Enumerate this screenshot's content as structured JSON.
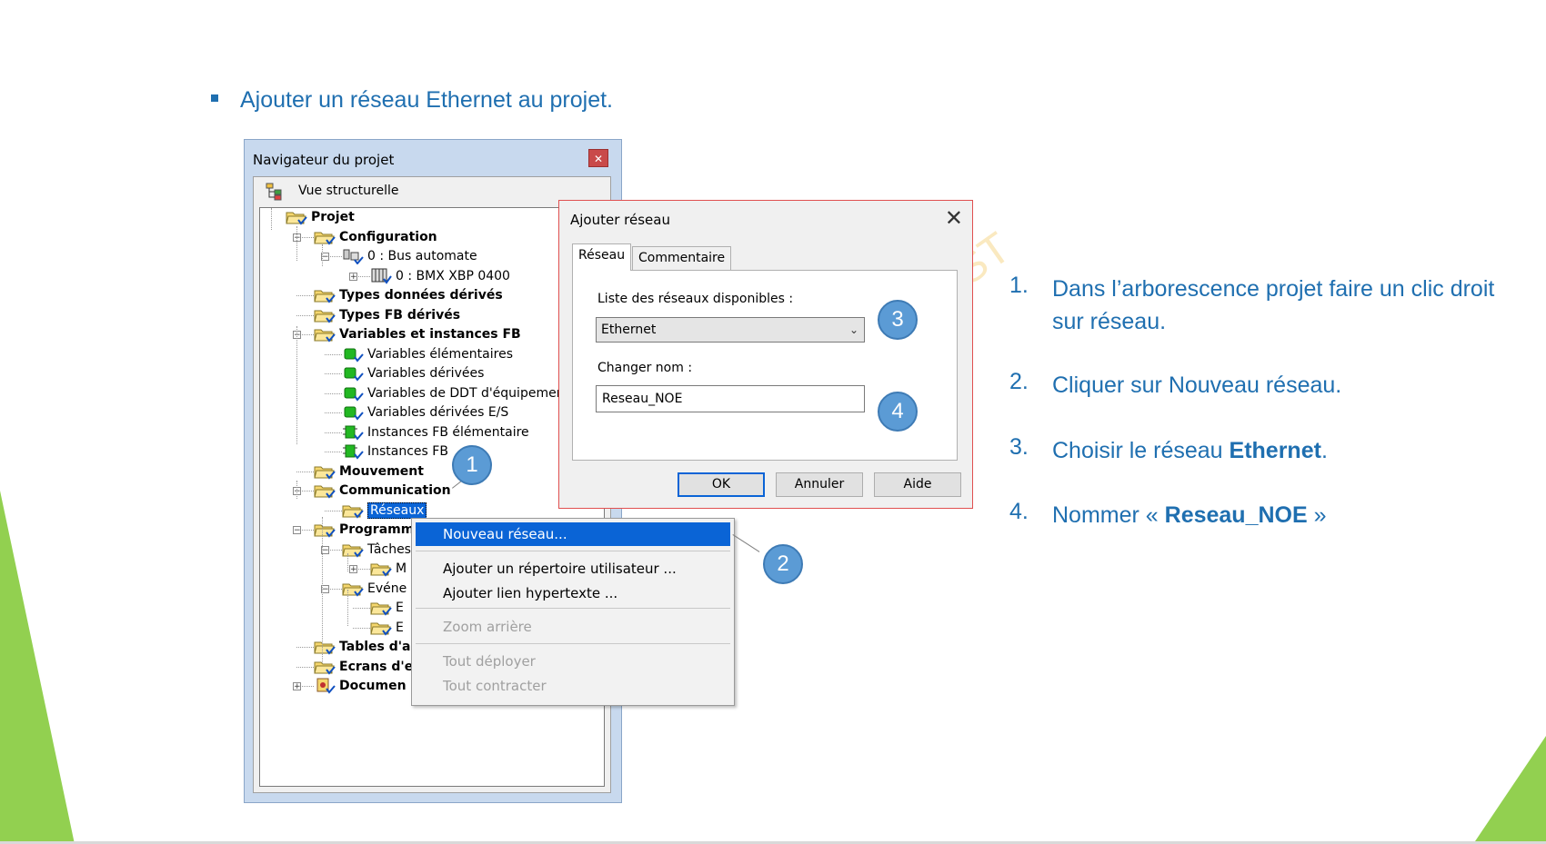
{
  "slide": {
    "title": "Ajouter un réseau Ethernet au projet.",
    "watermark": "ST",
    "colors": {
      "accent": "#1f6fb0",
      "green": "#92d050",
      "callout": "#5b9bd5"
    }
  },
  "navigator": {
    "title": "Navigateur du projet",
    "close_icon": "close-icon",
    "view_label": "Vue structurelle",
    "tree": [
      {
        "label": "Projet",
        "bold": true
      },
      {
        "label": "Configuration",
        "bold": true
      },
      {
        "label": "0 : Bus automate",
        "bold": false
      },
      {
        "label": "0 : BMX XBP 0400",
        "bold": false
      },
      {
        "label": "Types données dérivés",
        "bold": true
      },
      {
        "label": "Types FB dérivés",
        "bold": true
      },
      {
        "label": "Variables et instances FB",
        "bold": true
      },
      {
        "label": "Variables élémentaires",
        "bold": false
      },
      {
        "label": "Variables dérivées",
        "bold": false
      },
      {
        "label": "Variables de DDT d'équipement",
        "bold": false
      },
      {
        "label": "Variables dérivées E/S",
        "bold": false
      },
      {
        "label": "Instances FB élémentaire",
        "bold": false
      },
      {
        "label": "Instances FB",
        "bold": false
      },
      {
        "label": "Mouvement",
        "bold": true
      },
      {
        "label": "Communication",
        "bold": true
      },
      {
        "label": "Réseaux",
        "bold": false,
        "selected": true
      },
      {
        "label": "Programm",
        "bold": true
      },
      {
        "label": "Tâches",
        "bold": false
      },
      {
        "label": "M",
        "bold": false
      },
      {
        "label": "Evéne",
        "bold": false
      },
      {
        "label": "E",
        "bold": false
      },
      {
        "label": "E",
        "bold": false
      },
      {
        "label": "Tables d'a",
        "bold": true
      },
      {
        "label": "Ecrans d'e",
        "bold": true
      },
      {
        "label": "Documen",
        "bold": true
      }
    ]
  },
  "context_menu": {
    "items": [
      {
        "label": "Nouveau réseau...",
        "state": "highlighted"
      },
      {
        "label": "Ajouter un répertoire utilisateur ...",
        "state": "enabled"
      },
      {
        "label": "Ajouter lien hypertexte ...",
        "state": "enabled"
      },
      {
        "label": "Zoom arrière",
        "state": "disabled"
      },
      {
        "label": "Tout déployer",
        "state": "disabled"
      },
      {
        "label": "Tout contracter",
        "state": "disabled"
      }
    ]
  },
  "dialog": {
    "title": "Ajouter réseau",
    "tabs": [
      "Réseau",
      "Commentaire"
    ],
    "list_label": "Liste des réseaux disponibles :",
    "selected_network": "Ethernet",
    "rename_label": "Changer nom :",
    "name_value": "Reseau_NOE",
    "buttons": {
      "ok": "OK",
      "cancel": "Annuler",
      "help": "Aide"
    }
  },
  "callouts": [
    "1",
    "2",
    "3",
    "4"
  ],
  "steps": [
    {
      "num": "1.",
      "text": "Dans l’arborescence projet faire un clic droit sur réseau."
    },
    {
      "num": "2.",
      "text": "Cliquer sur Nouveau réseau."
    },
    {
      "num": "3.",
      "pre": "Choisir le réseau ",
      "bold": "Ethernet",
      "post": "."
    },
    {
      "num": "4.",
      "pre": "Nommer « ",
      "bold": "Reseau_NOE",
      "post": " »"
    }
  ]
}
